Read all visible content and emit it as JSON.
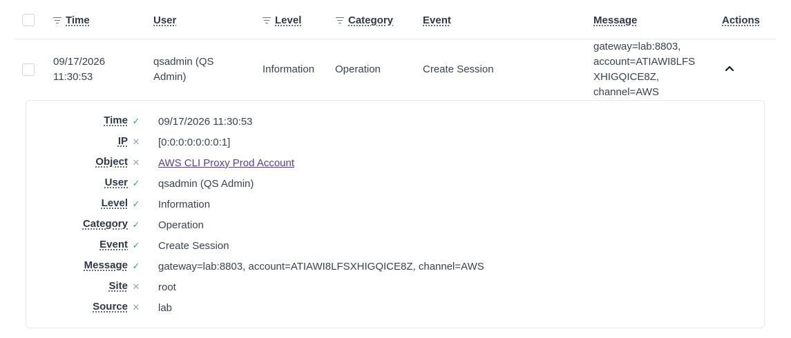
{
  "header": {
    "columns": [
      {
        "label": "Time",
        "filter": "active"
      },
      {
        "label": "User",
        "filter": "none"
      },
      {
        "label": "Level",
        "filter": "inactive"
      },
      {
        "label": "Category",
        "filter": "inactive"
      },
      {
        "label": "Event",
        "filter": "none"
      },
      {
        "label": "Message",
        "filter": "none"
      },
      {
        "label": "Actions",
        "filter": "none"
      }
    ]
  },
  "row": {
    "time_line1": "09/17/2026",
    "time_line2": "11:30:53",
    "user_line1": "qsadmin (QS",
    "user_line2": "Admin)",
    "level": "Information",
    "category": "Operation",
    "event": "Create Session",
    "message_lines": [
      "gateway=lab:8803,",
      "account=ATIAWI8LFS",
      "XHIGQICE8Z,",
      "channel=AWS"
    ],
    "actions_icon": "chevron-up-icon"
  },
  "detail": {
    "fields": [
      {
        "label": "Time",
        "status": "check",
        "value": "09/17/2026 11:30:53"
      },
      {
        "label": "IP",
        "status": "cross",
        "value": "[0:0:0:0:0:0:0:1]"
      },
      {
        "label": "Object",
        "status": "cross",
        "value": "AWS CLI Proxy Prod Account",
        "link": true
      },
      {
        "label": "User",
        "status": "check",
        "value": "qsadmin (QS Admin)"
      },
      {
        "label": "Level",
        "status": "check",
        "value": "Information"
      },
      {
        "label": "Category",
        "status": "check",
        "value": "Operation"
      },
      {
        "label": "Event",
        "status": "check",
        "value": "Create Session"
      },
      {
        "label": "Message",
        "status": "check",
        "value": "gateway=lab:8803, account=ATIAWI8LFSXHIGQICE8Z, channel=AWS"
      },
      {
        "label": "Site",
        "status": "cross",
        "value": "root"
      },
      {
        "label": "Source",
        "status": "cross",
        "value": "lab"
      }
    ]
  },
  "colors": {
    "active_filter": "#e53e3e",
    "check": "#38a169",
    "cross": "#9ca3af",
    "link": "#553c9a"
  }
}
